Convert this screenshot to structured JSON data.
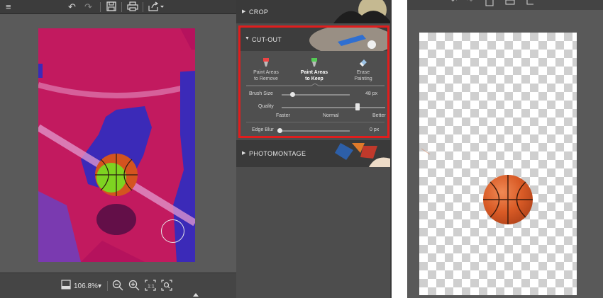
{
  "toolbar": {
    "menu_icon": "hamburger-icon",
    "undo_icon": "undo-icon",
    "redo_icon": "redo-icon",
    "save_icon": "save-icon",
    "print_icon": "print-icon",
    "export_icon": "export-icon"
  },
  "bottombar": {
    "zoom_value": "106.8%",
    "zoom_dropdown_glyph": "▾"
  },
  "panel": {
    "crop_label": "CROP",
    "cutout_label": "CUT-OUT",
    "photomontage_label": "PHOTOMONTAGE",
    "tools": [
      {
        "line1": "Paint Areas",
        "line2": "to Remove"
      },
      {
        "line1": "Paint Areas",
        "line2": "to Keep"
      },
      {
        "line1": "Erase",
        "line2": "Painting"
      }
    ],
    "brush_size_label": "Brush Size",
    "brush_size_value": "48 px",
    "quality_label": "Quality",
    "quality_faster": "Faster",
    "quality_normal": "Normal",
    "quality_better": "Better",
    "edge_blur_label": "Edge Blur",
    "edge_blur_value": "0 px"
  },
  "colors": {
    "highlight": "#e01d1d",
    "keep_paint": "#7ed321",
    "remove_paint": "#c2185b"
  }
}
